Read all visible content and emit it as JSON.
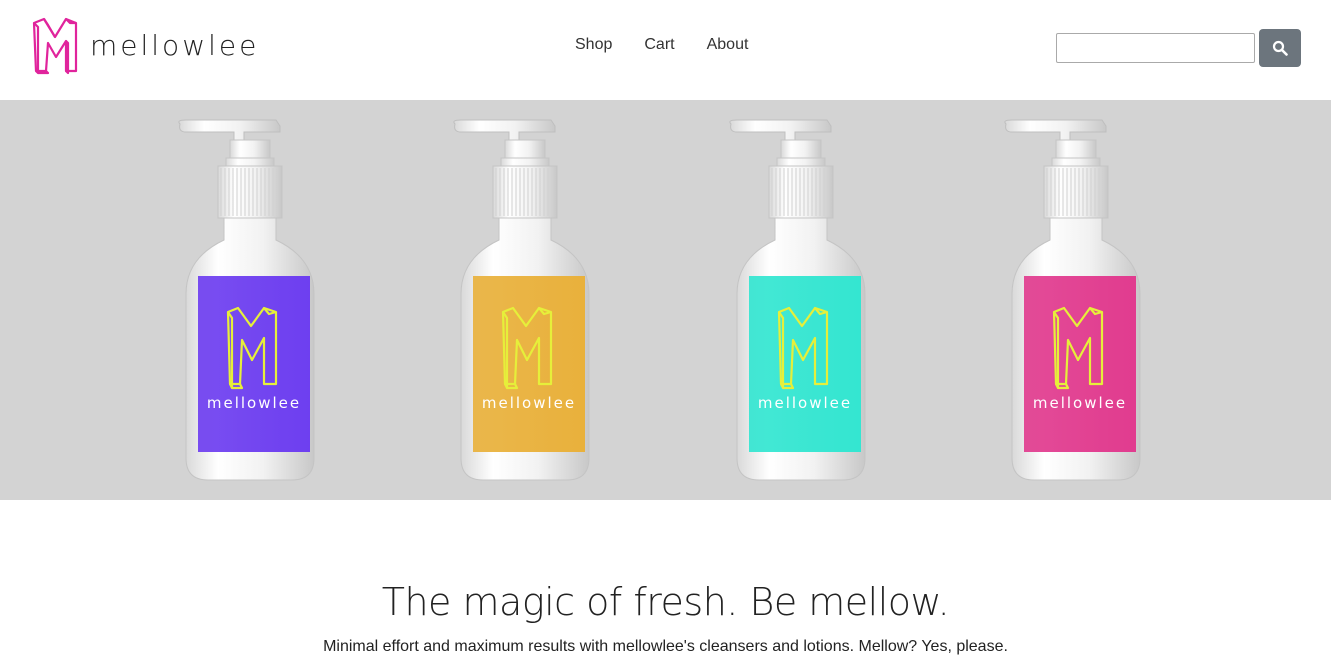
{
  "brand": {
    "name": "mellowlee",
    "accent": "#e0249c"
  },
  "nav": {
    "items": [
      "Shop",
      "Cart",
      "About"
    ]
  },
  "search": {
    "placeholder": "",
    "value": "",
    "button_icon": "search-icon"
  },
  "hero": {
    "background": "#d3d3d3",
    "bottles": [
      {
        "label_color": "#6e3ff0",
        "brand_text": "mellowlee"
      },
      {
        "label_color": "#e9b13c",
        "brand_text": "mellowlee"
      },
      {
        "label_color": "#34e6d1",
        "brand_text": "mellowlee"
      },
      {
        "label_color": "#e13c8f",
        "brand_text": "mellowlee"
      }
    ],
    "logo_stroke": "#e6ef3a"
  },
  "main": {
    "headline": "The magic of fresh. Be mellow.",
    "subheadline": "Minimal effort and maximum results with mellowlee's cleansers and lotions. Mellow? Yes, please."
  }
}
